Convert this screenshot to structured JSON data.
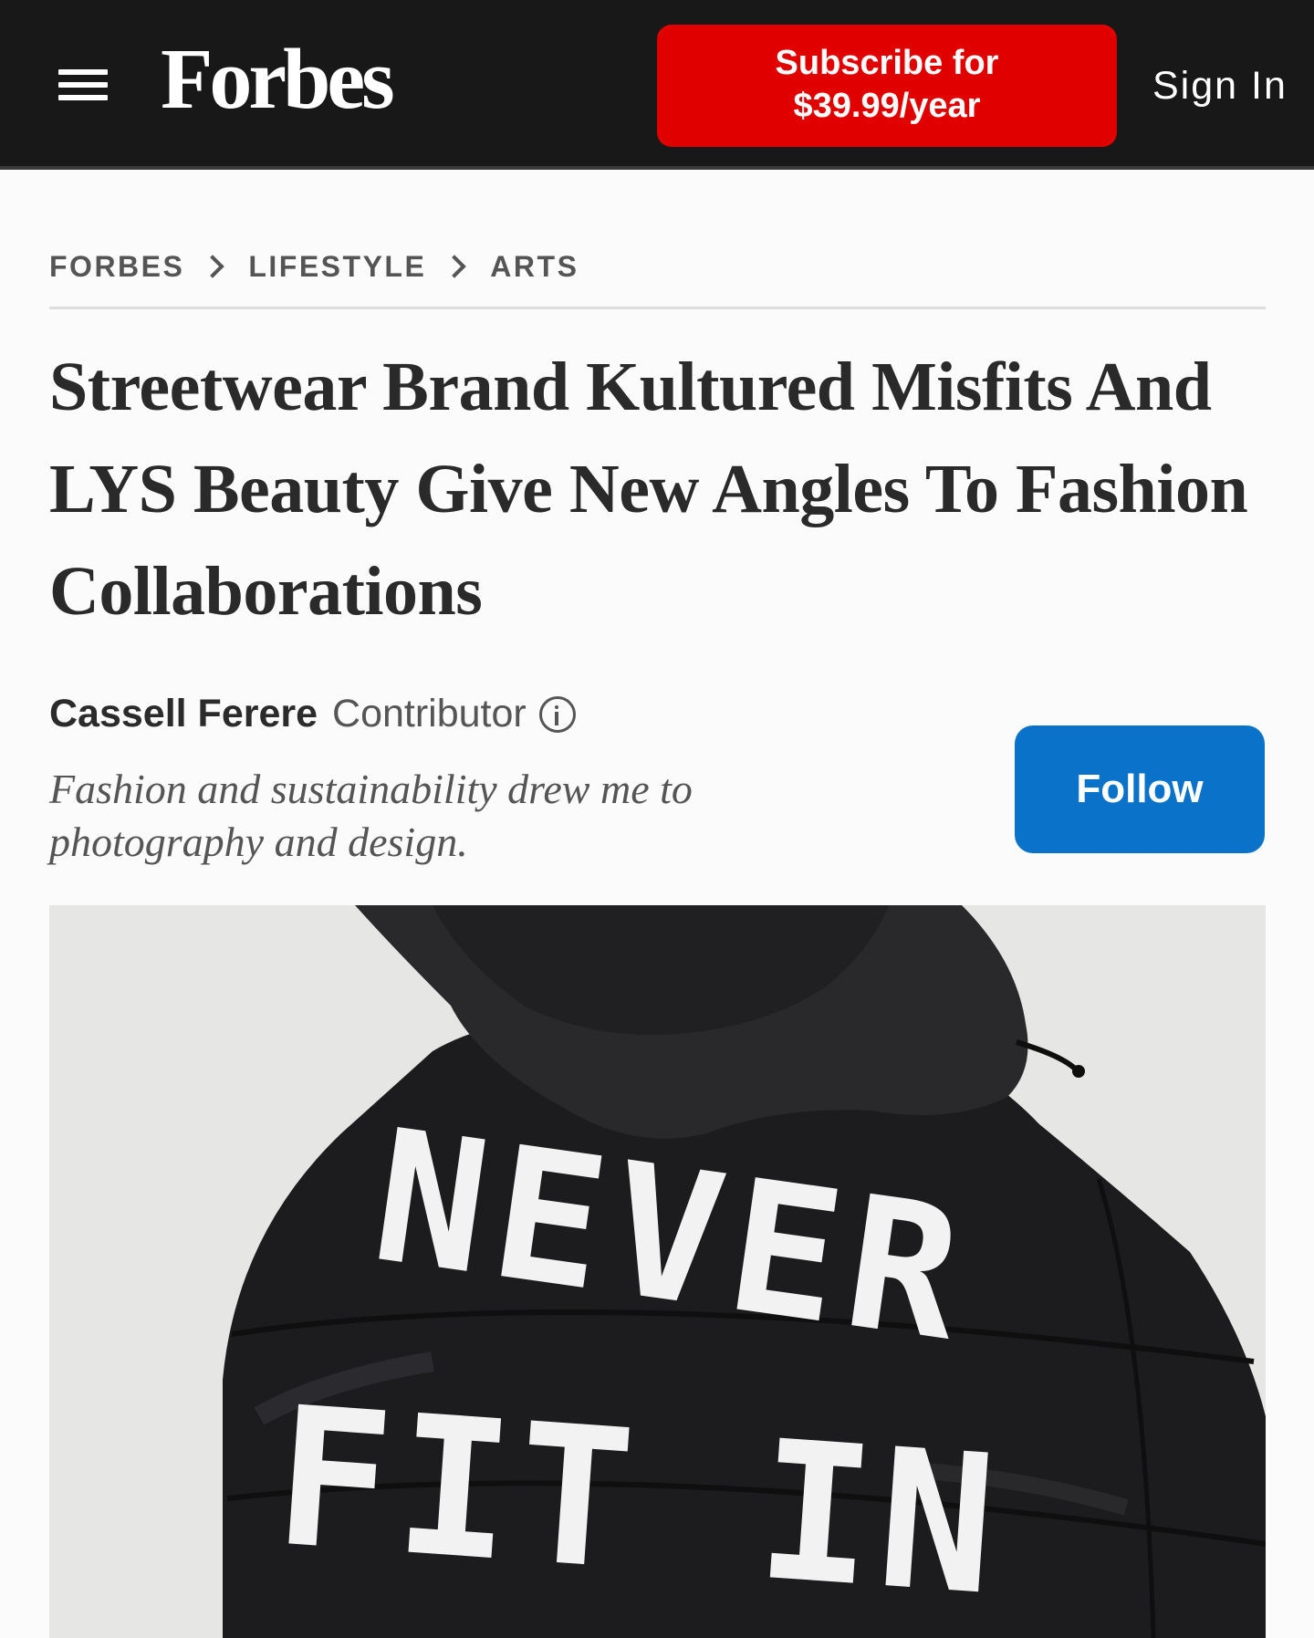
{
  "header": {
    "logo": "Forbes",
    "subscribe_line1": "Subscribe for",
    "subscribe_line2": "$39.99/year",
    "signin": "Sign In"
  },
  "breadcrumb": [
    "FORBES",
    "LIFESTYLE",
    "ARTS"
  ],
  "article": {
    "headline": "Streetwear Brand Kultured Misfits And LYS Beauty Give New Angles To Fashion Collaborations"
  },
  "author": {
    "name": "Cassell Ferere",
    "role": "Contributor",
    "bio": "Fashion and sustainability drew me to photography and design.",
    "follow_label": "Follow"
  },
  "hero_image": {
    "jacket_text_line1": "NEVER",
    "jacket_text_line2": "FIT IN"
  },
  "colors": {
    "header_bg": "#181818",
    "subscribe_bg": "#e00000",
    "follow_bg": "#0b72c9"
  }
}
